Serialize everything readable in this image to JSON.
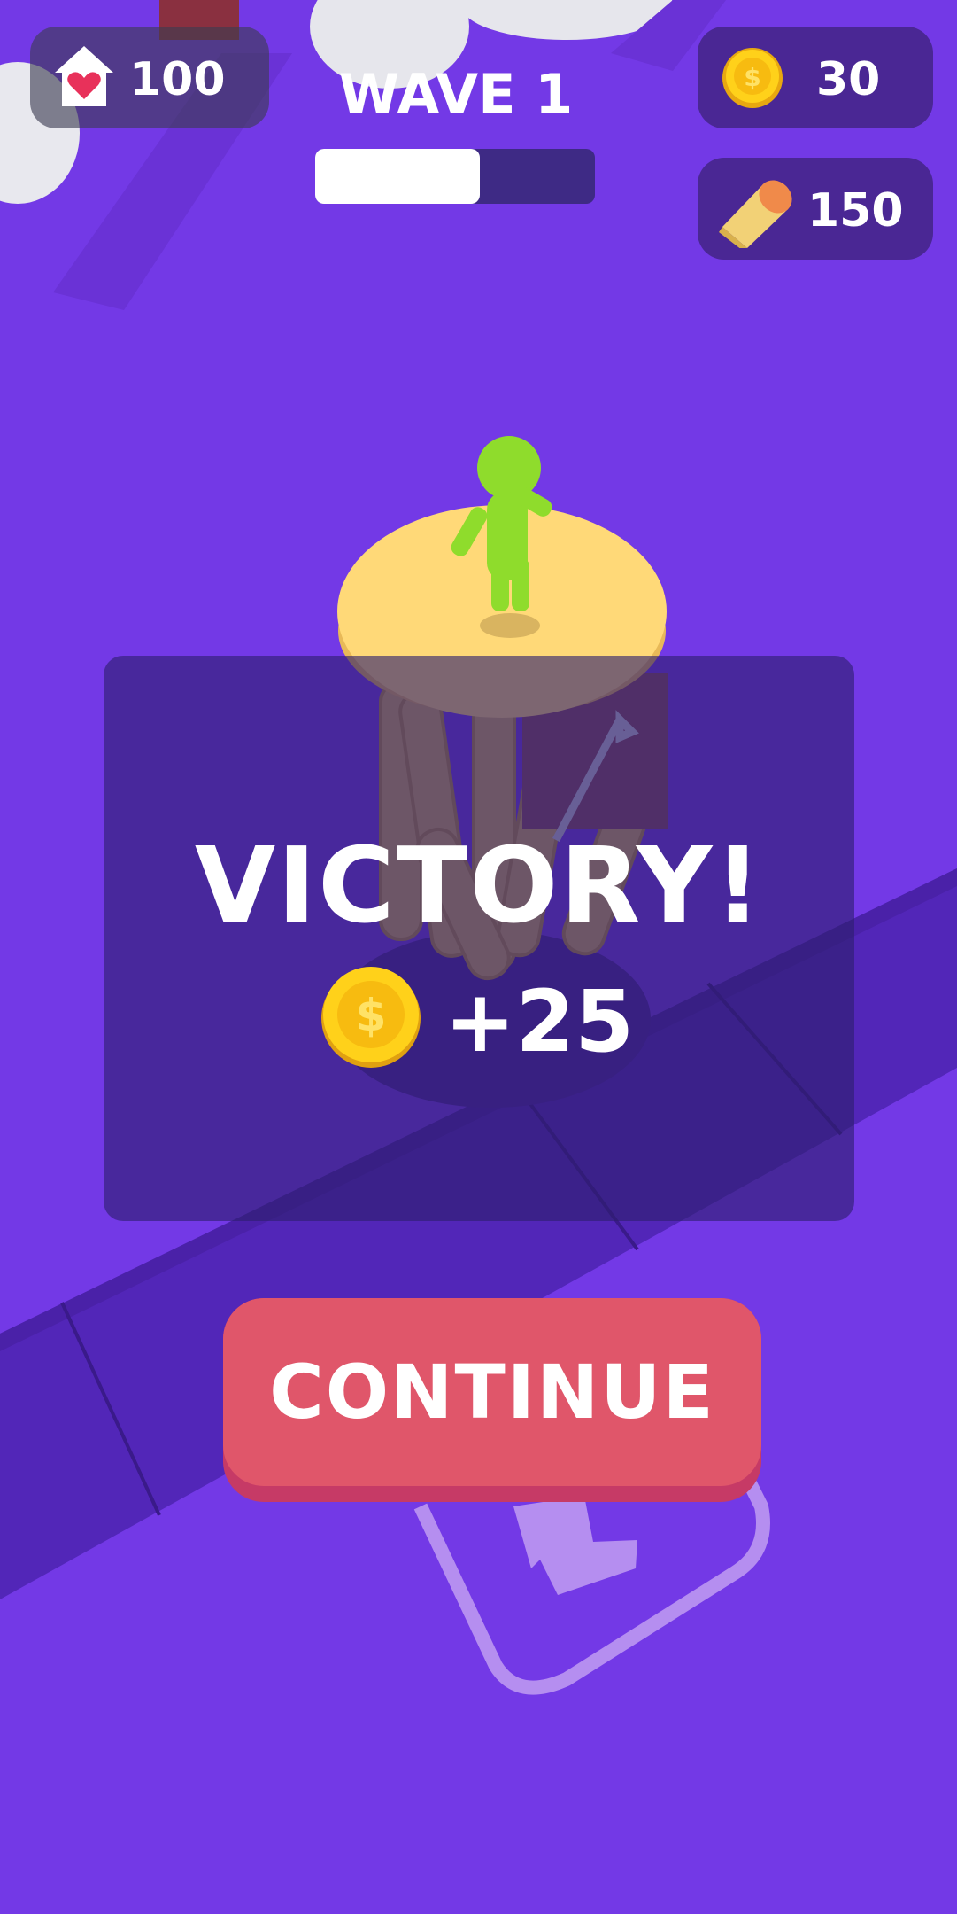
{
  "hud": {
    "health": "100",
    "wave_label": "WAVE 1",
    "wave_progress": 0.59,
    "coins": "30",
    "wood": "150"
  },
  "result": {
    "title": "VICTORY!",
    "reward": "+25"
  },
  "continue_label": "CONTINUE",
  "icons": {
    "health": "house-heart-icon",
    "coin": "gold-coin-icon",
    "wood": "wood-log-icon"
  },
  "colors": {
    "background": "#7339e6",
    "button": "#e0566a",
    "heart": "#e8315a",
    "coin": "#f6c21c",
    "character": "#8fdc2c"
  }
}
